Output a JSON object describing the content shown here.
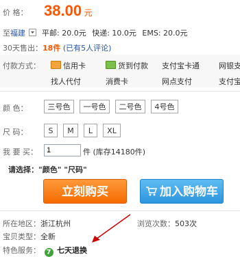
{
  "price": {
    "label": "价    格：",
    "value": "38.00",
    "unit": "元"
  },
  "shipping": {
    "to_prefix": "至",
    "destination": "福建",
    "methods": [
      "平邮: 20.0元",
      "快递: 10.0元",
      "EMS: 20.0元"
    ]
  },
  "sales": {
    "label": "30天售出：",
    "count": "18",
    "unit": "件",
    "reviews_text": "(已有5人评论)"
  },
  "payment": {
    "label": "付款方式：",
    "methods_row1": [
      "信用卡",
      "货到付款",
      "支付宝卡通",
      "网银支"
    ],
    "methods_row2": [
      "找人代付",
      "消费卡",
      "网点支付",
      "支付宝"
    ]
  },
  "color": {
    "label": "颜    色：",
    "options": [
      "三号色",
      "一号色",
      "二号色",
      "4号色"
    ]
  },
  "size": {
    "label": "尺    码：",
    "options": [
      "S",
      "M",
      "L",
      "XL"
    ]
  },
  "quantity": {
    "label": "我 要 买：",
    "value": "1",
    "unit": "件",
    "stock": "(库存14180件)"
  },
  "selection_prompt": "请选择：\"颜色\" \"尺码\"",
  "actions": {
    "buy_now": "立刻购买",
    "add_to_cart": "加入购物车"
  },
  "info": {
    "location_label": "所在地区：",
    "location_value": "浙江杭州",
    "views_label": "浏览次数：",
    "views_value": "503次",
    "type_label": "宝贝类型：",
    "type_value": "全新",
    "service_label": "特色服务：",
    "service_badge": "7",
    "service_value": "七天退换"
  },
  "colors": {
    "accent": "#ff5500",
    "link": "#2953a6",
    "buy_button": "#f57a10",
    "cart_button": "#3ba6e8",
    "annotation_arrow": "#cc0000"
  }
}
